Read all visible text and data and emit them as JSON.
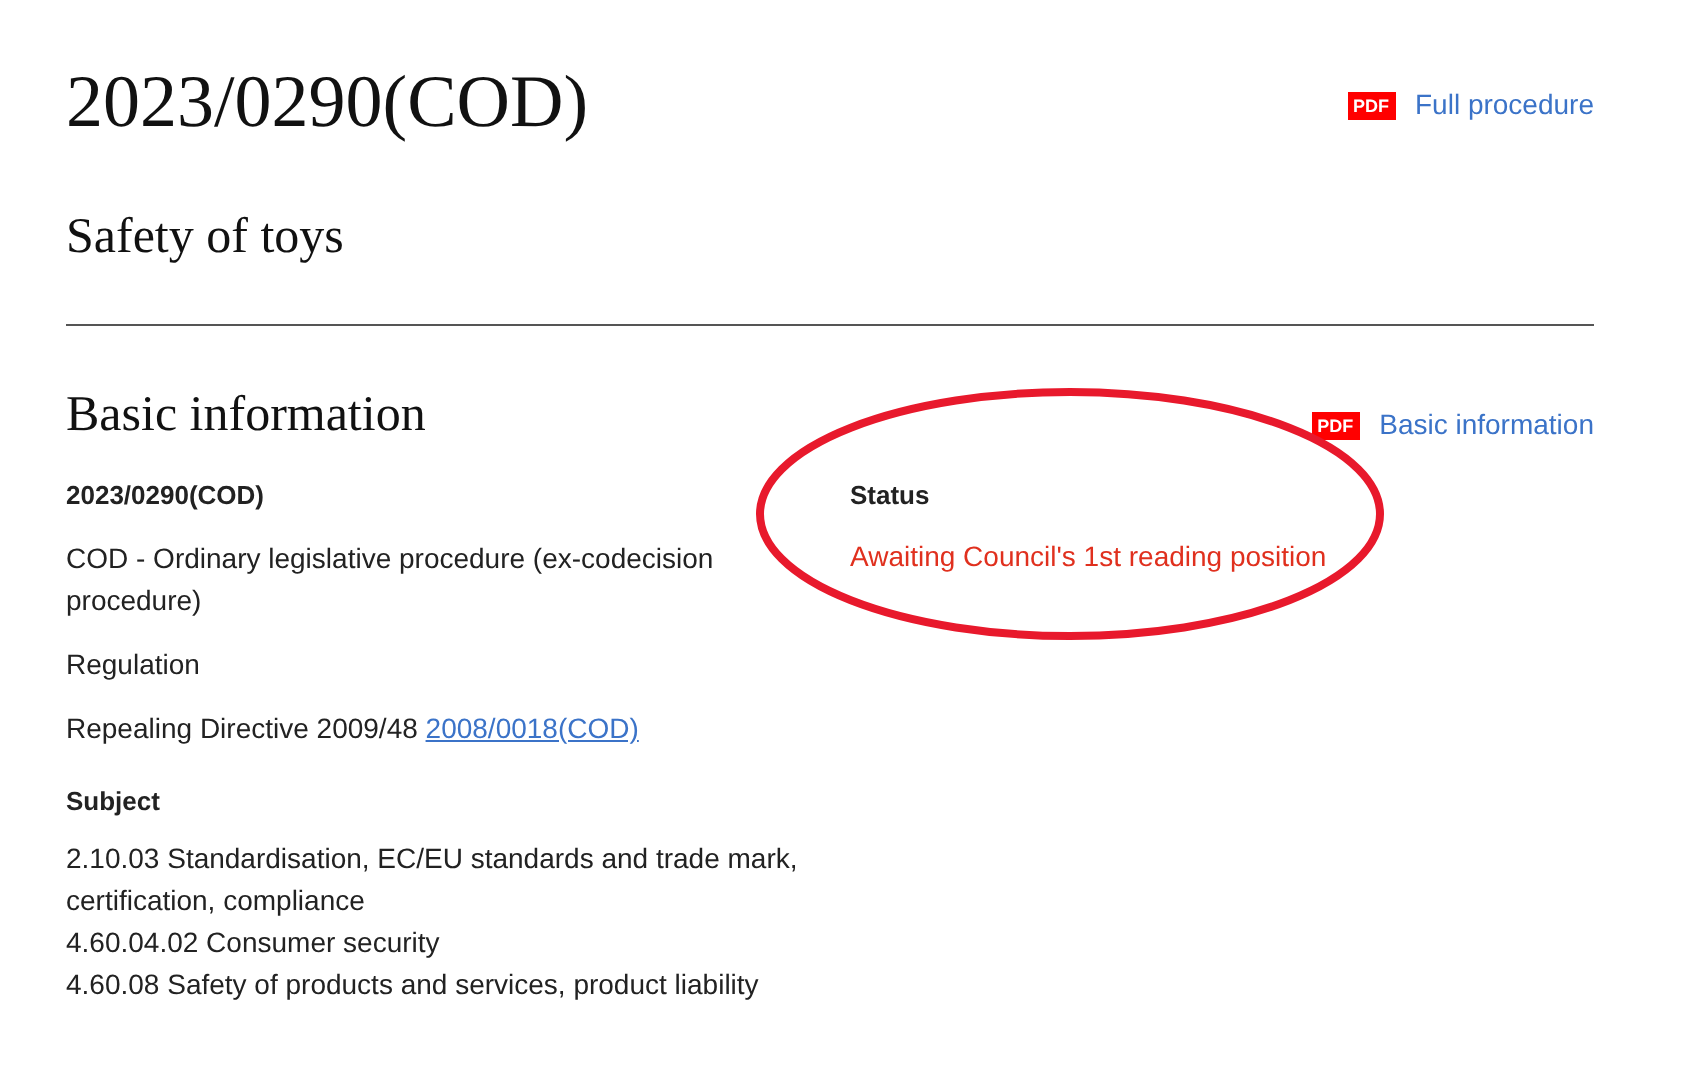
{
  "header": {
    "title": "2023/0290(COD)",
    "subtitle": "Safety of toys",
    "link": {
      "badge": "PDF",
      "label": "Full procedure"
    }
  },
  "basic_information": {
    "heading": "Basic information",
    "link": {
      "badge": "PDF",
      "label": "Basic information"
    },
    "reference": "2023/0290(COD)",
    "paragraphs": [
      {
        "text": "COD - Ordinary legislative procedure (ex-codecision procedure)"
      },
      {
        "text": "Regulation"
      },
      {
        "text": "Repealing Directive 2009/48",
        "link": "2008/0018(COD)"
      }
    ],
    "subject": {
      "heading": "Subject",
      "lines": [
        "2.10.03 Standardisation, EC/EU standards and trade mark, certification, compliance",
        "4.60.04.02 Consumer security",
        "4.60.08 Safety of products and services, product liability"
      ]
    },
    "status": {
      "heading": "Status",
      "value": "Awaiting Council's 1st reading position",
      "circled": true
    }
  }
}
